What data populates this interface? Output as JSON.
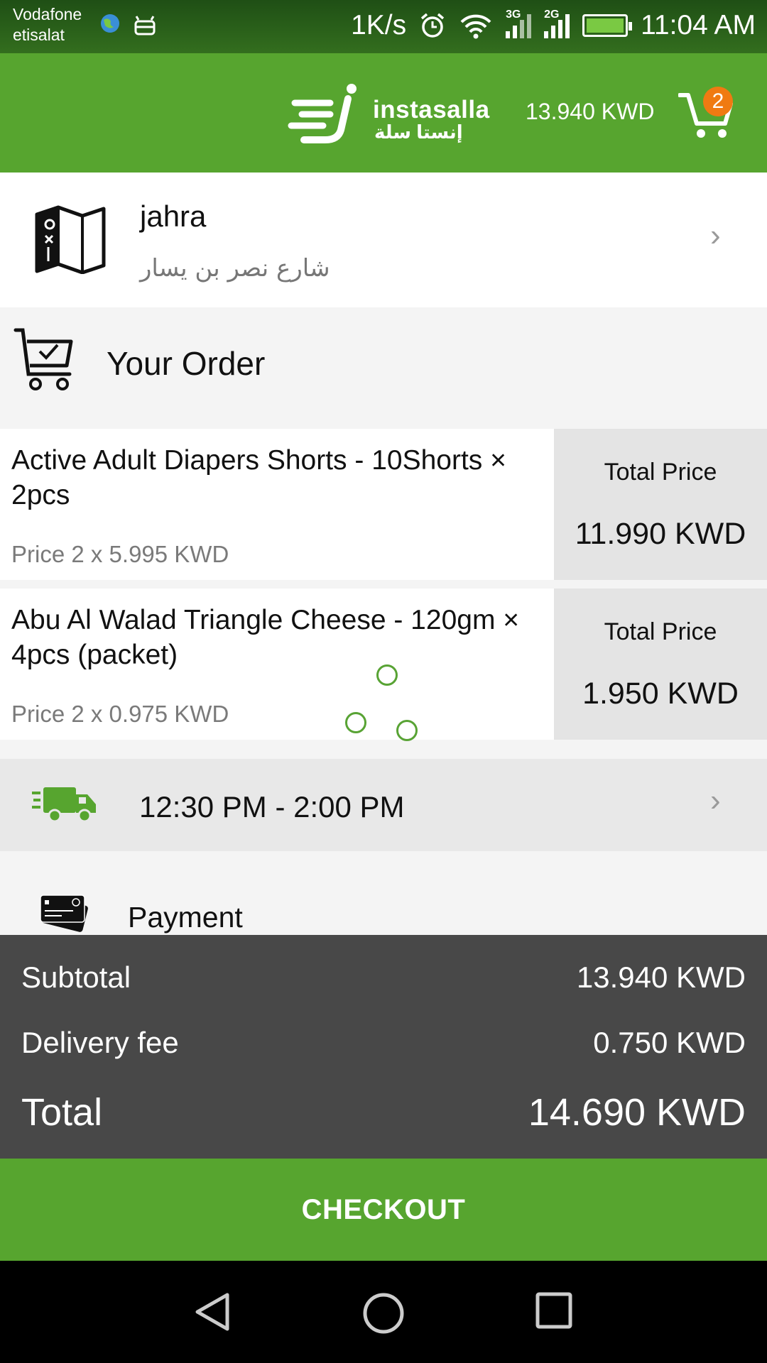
{
  "status_bar": {
    "carrier_line1": "Vodafone",
    "carrier_line2": "etisalat",
    "speed": "1K/s",
    "net1": "3G",
    "net2": "2G",
    "time": "11:04 AM"
  },
  "header": {
    "brand_en": "instasalla",
    "brand_ar": "إنستا سلة",
    "cart_total": "13.940 KWD",
    "cart_count": "2",
    "accent_color": "#57a52f",
    "badge_color": "#f07a12"
  },
  "address": {
    "city": "jahra",
    "street": "شارع نصر بن يسار"
  },
  "order": {
    "heading": "Your Order",
    "items": [
      {
        "name": "Active Adult Diapers Shorts - 10Shorts × 2pcs",
        "price_line": "Price 2 x 5.995  KWD",
        "total_label": "Total Price",
        "total_value": "11.990  KWD"
      },
      {
        "name": "Abu Al Walad Triangle Cheese - 120gm × 4pcs (packet)",
        "price_line": "Price 2 x 0.975  KWD",
        "total_label": "Total Price",
        "total_value": "1.950  KWD"
      }
    ]
  },
  "delivery": {
    "time_slot": "12:30 PM - 2:00 PM"
  },
  "payment": {
    "label": "Payment"
  },
  "summary": {
    "subtotal_label": "Subtotal",
    "subtotal_value": "13.940 KWD",
    "delivery_label": "Delivery fee",
    "delivery_value": "0.750 KWD",
    "total_label": "Total",
    "total_value": "14.690 KWD"
  },
  "checkout": {
    "label": "CHECKOUT"
  }
}
